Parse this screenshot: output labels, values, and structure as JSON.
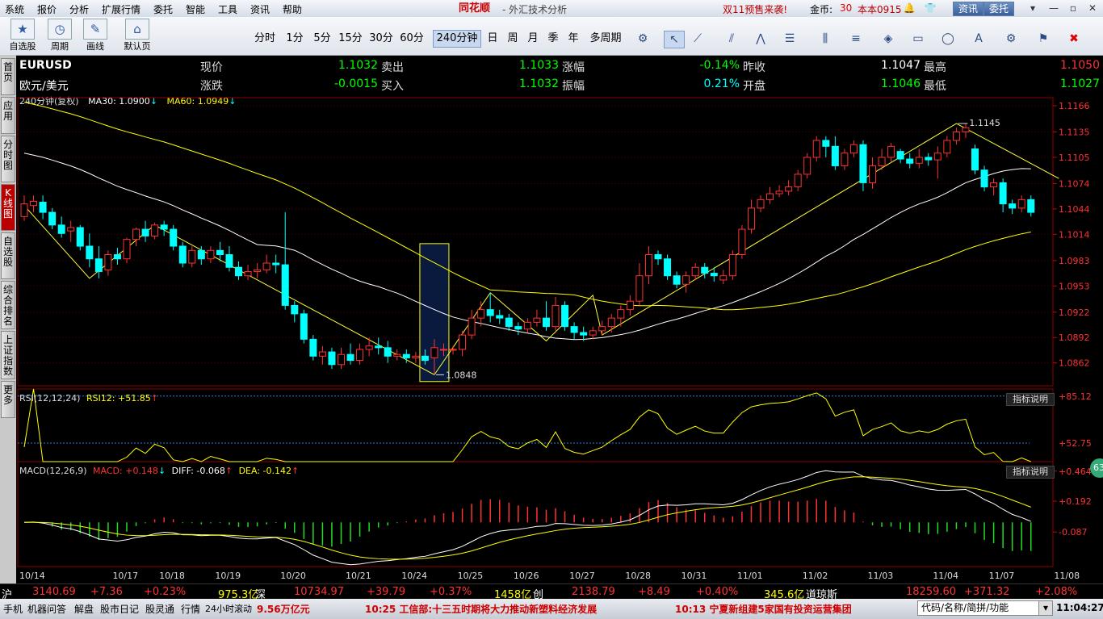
{
  "menu": [
    "系统",
    "报价",
    "分析",
    "扩展行情",
    "委托",
    "智能",
    "工具",
    "资讯",
    "帮助"
  ],
  "brand": {
    "logo": "同花顺",
    "subtitle": "- 外汇技术分析"
  },
  "promo": "双11预售来袭!",
  "gold": {
    "label": "金币:",
    "value": "30"
  },
  "version": "本本0915",
  "top_buttons": {
    "news": "资讯",
    "trade": "委托"
  },
  "toolbar": {
    "groups": [
      {
        "name": "自选股",
        "icon": "star-icon"
      },
      {
        "name": "周期",
        "icon": "clock-icon"
      },
      {
        "name": "画线",
        "icon": "pen-icon"
      },
      {
        "name": "默认页",
        "icon": "home-icon"
      }
    ],
    "timeframes": [
      "分时",
      "1分",
      "5分",
      "15分",
      "30分",
      "60分",
      "240分钟",
      "日",
      "周",
      "月",
      "季",
      "年",
      "多周期"
    ],
    "active_timeframe": "240分钟"
  },
  "left_tabs": [
    "首页",
    "应用",
    "分时图",
    "K线图",
    "自选股",
    "综合排名",
    "上证指数",
    "更多"
  ],
  "quote": {
    "symbol": "EURUSD",
    "name": "欧元/美元",
    "rows": [
      [
        {
          "l": "现价",
          "v": "1.1032",
          "c": "green"
        },
        {
          "l": "卖出",
          "v": "1.1033",
          "c": "green"
        },
        {
          "l": "涨幅",
          "v": "-0.14%",
          "c": "green"
        },
        {
          "l": "昨收",
          "v": "1.1047",
          "c": "white"
        },
        {
          "l": "最高",
          "v": "1.1050",
          "c": "red"
        }
      ],
      [
        {
          "l": "涨跌",
          "v": "-0.0015",
          "c": "green"
        },
        {
          "l": "买入",
          "v": "1.1032",
          "c": "green"
        },
        {
          "l": "振幅",
          "v": "0.21%",
          "c": "cyan"
        },
        {
          "l": "开盘",
          "v": "1.1046",
          "c": "green"
        },
        {
          "l": "最低",
          "v": "1.1027",
          "c": "green"
        }
      ]
    ]
  },
  "main_legend": {
    "period": "240分钟(复权)",
    "ma30": "MA30: 1.0900",
    "ma60": "MA60: 1.0949"
  },
  "rsi_legend": {
    "name": "RSI(12,12,24)",
    "value": "RSI12: +51.85"
  },
  "macd_legend": {
    "name": "MACD(12,26,9)",
    "macd": "MACD: +0.148",
    "diff": "DIFF: -0.068",
    "dea": "DEA: -0.142"
  },
  "indicator_help": "指标说明",
  "badge": "63",
  "date_labels": [
    "10/14",
    "10/17",
    "10/18",
    "10/19",
    "10/20",
    "10/21",
    "10/24",
    "10/25",
    "10/26",
    "10/27",
    "10/28",
    "10/31",
    "11/01",
    "11/02",
    "11/03",
    "11/04",
    "11/07",
    "11/08"
  ],
  "index_bar": [
    {
      "t": "沪",
      "c": "white"
    },
    {
      "t": "3140.69",
      "c": "red"
    },
    {
      "t": "+7.36",
      "c": "red"
    },
    {
      "t": "+0.23%",
      "c": "red"
    },
    {
      "t": "975.3亿",
      "c": "yellow"
    },
    {
      "t": "深",
      "c": "white"
    },
    {
      "t": "10734.97",
      "c": "red"
    },
    {
      "t": "+39.79",
      "c": "red"
    },
    {
      "t": "+0.37%",
      "c": "red"
    },
    {
      "t": "1458亿",
      "c": "yellow"
    },
    {
      "t": "创",
      "c": "white"
    },
    {
      "t": "2138.79",
      "c": "red"
    },
    {
      "t": "+8.49",
      "c": "red"
    },
    {
      "t": "+0.40%",
      "c": "red"
    },
    {
      "t": "345.6亿",
      "c": "yellow"
    },
    {
      "t": "道琼斯",
      "c": "white"
    },
    {
      "t": "18259.60",
      "c": "red"
    },
    {
      "t": "+371.32",
      "c": "red"
    },
    {
      "t": "+2.08%",
      "c": "red"
    }
  ],
  "bottom_bar": {
    "items": [
      "手机",
      "机器问答",
      "解盘",
      "股市日记",
      "股灵通",
      "行情",
      "24小时滚动"
    ],
    "volume": "9.56万亿元",
    "news1": "10:25 工信部:十三五时期将大力推动新塑料经济发展",
    "news2": "10:13 宁夏新组建5家国有投资运营集团",
    "search": "代码/名称/简拼/功能",
    "clock": "11:04:27"
  },
  "chart_data": {
    "type": "candlestick",
    "symbol": "EURUSD",
    "period": "240分钟",
    "price_ticks": [
      "1.1166",
      "1.1135",
      "1.1105",
      "1.1074",
      "1.1044",
      "1.1014",
      "1.0983",
      "1.0953",
      "1.0922",
      "1.0892",
      "1.0862"
    ],
    "ylim": [
      1.0835,
      1.1166
    ],
    "annotations": {
      "high": "1.1145",
      "low": "1.0848"
    },
    "candles": [
      [
        1.1035,
        1.105,
        1.106,
        1.103
      ],
      [
        1.1048,
        1.1053,
        1.106,
        1.104
      ],
      [
        1.1052,
        1.104,
        1.106,
        1.1032
      ],
      [
        1.104,
        1.1025,
        1.1045,
        1.102
      ],
      [
        1.1025,
        1.1015,
        1.1035,
        1.101
      ],
      [
        1.1018,
        1.1022,
        1.103,
        1.1005
      ],
      [
        1.1022,
        1.1,
        1.1025,
        1.0995
      ],
      [
        1.1,
        1.0985,
        1.1015,
        1.0975
      ],
      [
        1.0985,
        1.097,
        1.1,
        1.0962
      ],
      [
        1.0972,
        1.099,
        1.0995,
        1.0965
      ],
      [
        1.099,
        1.0985,
        1.0998,
        1.0978
      ],
      [
        1.0985,
        1.1008,
        1.101,
        1.098
      ],
      [
        1.1008,
        1.102,
        1.1022,
        1.1
      ],
      [
        1.102,
        1.1012,
        1.103,
        1.1005
      ],
      [
        1.1012,
        1.1025,
        1.1028,
        1.1008
      ],
      [
        1.1025,
        1.102,
        1.103,
        1.1012
      ],
      [
        1.102,
        1.1,
        1.1025,
        1.0995
      ],
      [
        1.1,
        1.098,
        1.1005,
        1.0975
      ],
      [
        1.098,
        1.0995,
        1.1,
        1.0975
      ],
      [
        1.0995,
        1.0985,
        1.1,
        1.0978
      ],
      [
        1.0985,
        1.0995,
        1.1,
        1.098
      ],
      [
        1.0995,
        1.099,
        1.1005,
        1.0982
      ],
      [
        1.099,
        1.0975,
        1.1,
        1.097
      ],
      [
        1.0975,
        1.0965,
        1.0982,
        1.096
      ],
      [
        1.0965,
        1.097,
        1.0978,
        1.096
      ],
      [
        1.097,
        1.0972,
        1.098,
        1.0962
      ],
      [
        1.0972,
        1.098,
        1.099,
        1.0968
      ],
      [
        1.098,
        1.0978,
        1.099,
        1.0968
      ],
      [
        1.0978,
        1.093,
        1.104,
        1.0925
      ],
      [
        1.093,
        1.092,
        1.0935,
        1.091
      ],
      [
        1.092,
        1.089,
        1.0925,
        1.0885
      ],
      [
        1.089,
        1.087,
        1.0895,
        1.0865
      ],
      [
        1.087,
        1.0875,
        1.0882,
        1.086
      ],
      [
        1.0875,
        1.086,
        1.088,
        1.0855
      ],
      [
        1.086,
        1.0872,
        1.088,
        1.0855
      ],
      [
        1.0872,
        1.0865,
        1.0885,
        1.086
      ],
      [
        1.0865,
        1.0878,
        1.0885,
        1.086
      ],
      [
        1.0878,
        1.0882,
        1.0892,
        1.087
      ],
      [
        1.0882,
        1.088,
        1.0892,
        1.0872
      ],
      [
        1.088,
        1.087,
        1.0888,
        1.0862
      ],
      [
        1.087,
        1.0872,
        1.0878,
        1.0865
      ],
      [
        1.0872,
        1.0868,
        1.0878,
        1.0862
      ],
      [
        1.0868,
        1.087,
        1.0875,
        1.0862
      ],
      [
        1.087,
        1.0865,
        1.0878,
        1.086
      ],
      [
        1.0868,
        1.088,
        1.089,
        1.0848
      ],
      [
        1.0878,
        1.0878,
        1.0885,
        1.087
      ],
      [
        1.0878,
        1.0878,
        1.0882,
        1.0872
      ],
      [
        1.0878,
        1.0895,
        1.09,
        1.087
      ],
      [
        1.0895,
        1.0915,
        1.0925,
        1.089
      ],
      [
        1.0915,
        1.0925,
        1.0935,
        1.0905
      ],
      [
        1.0925,
        1.0918,
        1.0945,
        1.091
      ],
      [
        1.0918,
        1.0915,
        1.0925,
        1.0908
      ],
      [
        1.0915,
        1.0905,
        1.092,
        1.09
      ],
      [
        1.0905,
        1.0902,
        1.091,
        1.0895
      ],
      [
        1.0902,
        1.091,
        1.0915,
        1.0898
      ],
      [
        1.091,
        1.0915,
        1.0925,
        1.0905
      ],
      [
        1.0915,
        1.0905,
        1.0935,
        1.09
      ],
      [
        1.0905,
        1.093,
        1.094,
        1.09
      ],
      [
        1.093,
        1.0905,
        1.0935,
        1.09
      ],
      [
        1.0905,
        1.0898,
        1.091,
        1.089
      ],
      [
        1.0898,
        1.0895,
        1.0905,
        1.0888
      ],
      [
        1.0895,
        1.09,
        1.0905,
        1.089
      ],
      [
        1.09,
        1.0905,
        1.0912,
        1.0895
      ],
      [
        1.0905,
        1.0915,
        1.092,
        1.0898
      ],
      [
        1.0915,
        1.0925,
        1.093,
        1.0905
      ],
      [
        1.0925,
        1.0935,
        1.0942,
        1.0918
      ],
      [
        1.0935,
        1.0965,
        1.098,
        1.093
      ],
      [
        1.0965,
        1.099,
        1.1,
        1.0955
      ],
      [
        1.099,
        1.0985,
        1.0995,
        1.0978
      ],
      [
        1.0985,
        1.0965,
        1.099,
        1.096
      ],
      [
        1.0965,
        1.0955,
        1.097,
        1.095
      ],
      [
        1.0955,
        1.0965,
        1.097,
        1.0945
      ],
      [
        1.0965,
        1.0975,
        1.098,
        1.096
      ],
      [
        1.0975,
        1.0968,
        1.098,
        1.0962
      ],
      [
        1.0968,
        1.0965,
        1.0975,
        1.0958
      ],
      [
        1.096,
        1.0965,
        1.0972,
        1.0955
      ],
      [
        1.0965,
        1.099,
        1.0995,
        1.096
      ],
      [
        1.099,
        1.102,
        1.1025,
        1.0985
      ],
      [
        1.102,
        1.1045,
        1.1055,
        1.1015
      ],
      [
        1.1045,
        1.1055,
        1.106,
        1.104
      ],
      [
        1.1055,
        1.1062,
        1.107,
        1.105
      ],
      [
        1.1062,
        1.1065,
        1.1072,
        1.1058
      ],
      [
        1.1065,
        1.107,
        1.1078,
        1.106
      ],
      [
        1.107,
        1.1085,
        1.109,
        1.1065
      ],
      [
        1.1085,
        1.1105,
        1.111,
        1.108
      ],
      [
        1.1105,
        1.1125,
        1.113,
        1.11
      ],
      [
        1.1125,
        1.1118,
        1.113,
        1.1105
      ],
      [
        1.1118,
        1.1095,
        1.113,
        1.109
      ],
      [
        1.1095,
        1.111,
        1.1115,
        1.109
      ],
      [
        1.111,
        1.112,
        1.1125,
        1.1105
      ],
      [
        1.112,
        1.1075,
        1.1125,
        1.1065
      ],
      [
        1.1075,
        1.1095,
        1.1105,
        1.1068
      ],
      [
        1.1095,
        1.1105,
        1.1115,
        1.109
      ],
      [
        1.1105,
        1.1118,
        1.1122,
        1.11
      ],
      [
        1.1112,
        1.1103,
        1.1115,
        1.1098
      ],
      [
        1.1103,
        1.1098,
        1.111,
        1.1092
      ],
      [
        1.1098,
        1.1105,
        1.1115,
        1.1092
      ],
      [
        1.1105,
        1.1102,
        1.111,
        1.1095
      ],
      [
        1.1102,
        1.111,
        1.1118,
        1.108
      ],
      [
        1.111,
        1.1125,
        1.113,
        1.1105
      ],
      [
        1.1125,
        1.1135,
        1.114,
        1.112
      ],
      [
        1.1135,
        1.114,
        1.1145,
        1.1128
      ],
      [
        1.1115,
        1.109,
        1.112,
        1.1085
      ],
      [
        1.109,
        1.107,
        1.1095,
        1.1065
      ],
      [
        1.107,
        1.1075,
        1.108,
        1.106
      ],
      [
        1.1075,
        1.105,
        1.108,
        1.104
      ],
      [
        1.105,
        1.1045,
        1.1055,
        1.1038
      ],
      [
        1.1045,
        1.1055,
        1.106,
        1.104
      ],
      [
        1.1055,
        1.104,
        1.106,
        1.1035
      ]
    ],
    "rsi": {
      "ticks": [
        "+85.12",
        "+52.75"
      ],
      "range": [
        40,
        90
      ]
    },
    "macd": {
      "ticks": [
        "+0.464",
        "+0.192",
        "-0.087"
      ],
      "range": [
        -0.4,
        0.55
      ]
    }
  },
  "colors": {
    "up": "#ff3232",
    "down": "#00ffff",
    "ma30": "#ffffff",
    "ma60": "#ffff00",
    "wave": "#ffff33",
    "highlight": "#0a1a3f"
  }
}
